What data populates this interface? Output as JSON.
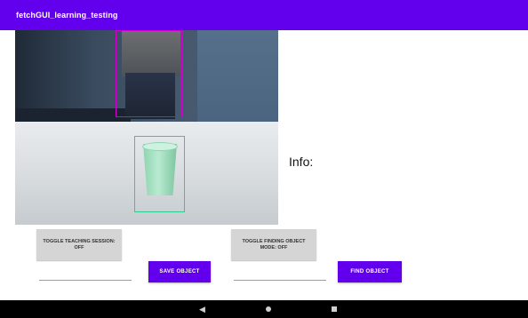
{
  "app_bar": {
    "title": "fetchGUI_learning_testing",
    "color": "#6200ee"
  },
  "camera_view": {
    "detections": [
      {
        "label": "person",
        "color": "#d000d0"
      },
      {
        "label": "cup",
        "color": "#2ecc8f"
      }
    ]
  },
  "info": {
    "label": "Info:"
  },
  "controls": {
    "teaching_toggle_label": "TOGGLE TEACHING SESSION: OFF",
    "finding_toggle_label": "TOGGLE FINDING OBJECT MODE: OFF",
    "save_object_label": "SAVE OBJECT",
    "find_object_label": "FIND OBJECT",
    "save_field_value": "",
    "find_field_value": ""
  },
  "nav_bar": {
    "back_icon": "back-icon",
    "home_icon": "home-icon",
    "recents_icon": "recents-icon"
  }
}
